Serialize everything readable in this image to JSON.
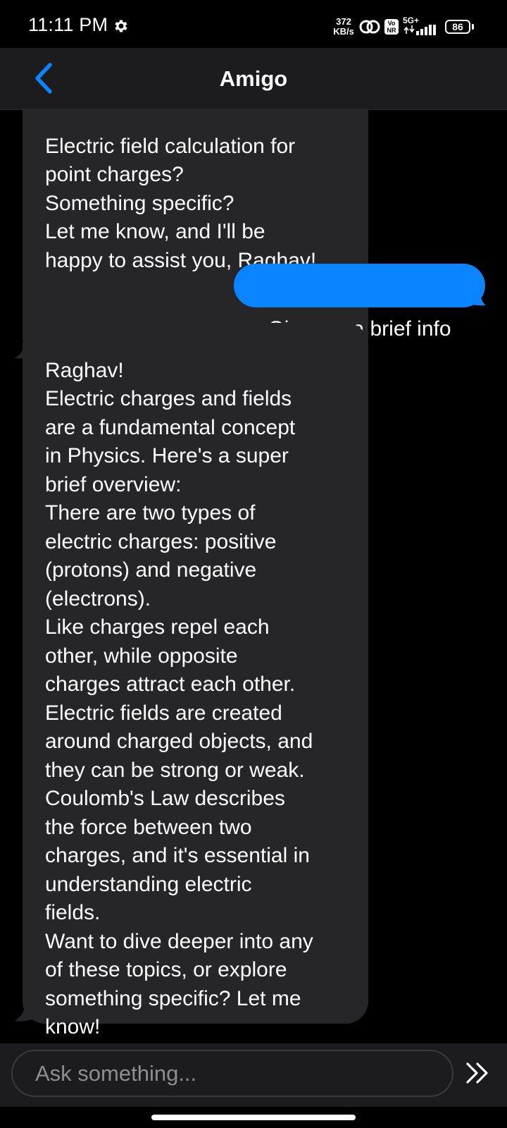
{
  "status_bar": {
    "time": "11:11 PM",
    "net_speed_value": "372",
    "net_speed_unit": "KB/s",
    "volte_top": "Vo",
    "volte_bottom": "NR",
    "network_type": "5G+",
    "battery_level": "86"
  },
  "header": {
    "title": "Amigo"
  },
  "messages": [
    {
      "sender": "bot",
      "text": "Electric field calculation for\npoint charges?\nSomething specific?\nLet me know, and I'll be\nhappy to assist you, Raghav!"
    },
    {
      "sender": "user",
      "text": "Give me a brief info"
    },
    {
      "sender": "bot",
      "text": "Raghav!\nElectric charges and fields\nare a fundamental concept\nin Physics. Here's a super\nbrief overview:\nThere are two types of\nelectric charges: positive\n(protons) and negative\n(electrons).\nLike charges repel each\nother, while opposite\ncharges attract each other.\nElectric fields are created\naround charged objects, and\nthey can be strong or weak.\nCoulomb's Law describes\nthe force between two\ncharges, and it's essential in\nunderstanding electric\nfields.\nWant to dive deeper into any\nof these topics, or explore\nsomething specific? Let me\nknow!"
    }
  ],
  "input": {
    "placeholder": "Ask something...",
    "value": ""
  },
  "icons": {
    "back": "chevron-left-icon",
    "send": "double-chevron-right-icon",
    "settings": "gear-icon"
  },
  "colors": {
    "accent": "#0a84ff",
    "bot_bubble": "#262628",
    "header_bg": "#1c1c1e",
    "background": "#000000"
  }
}
